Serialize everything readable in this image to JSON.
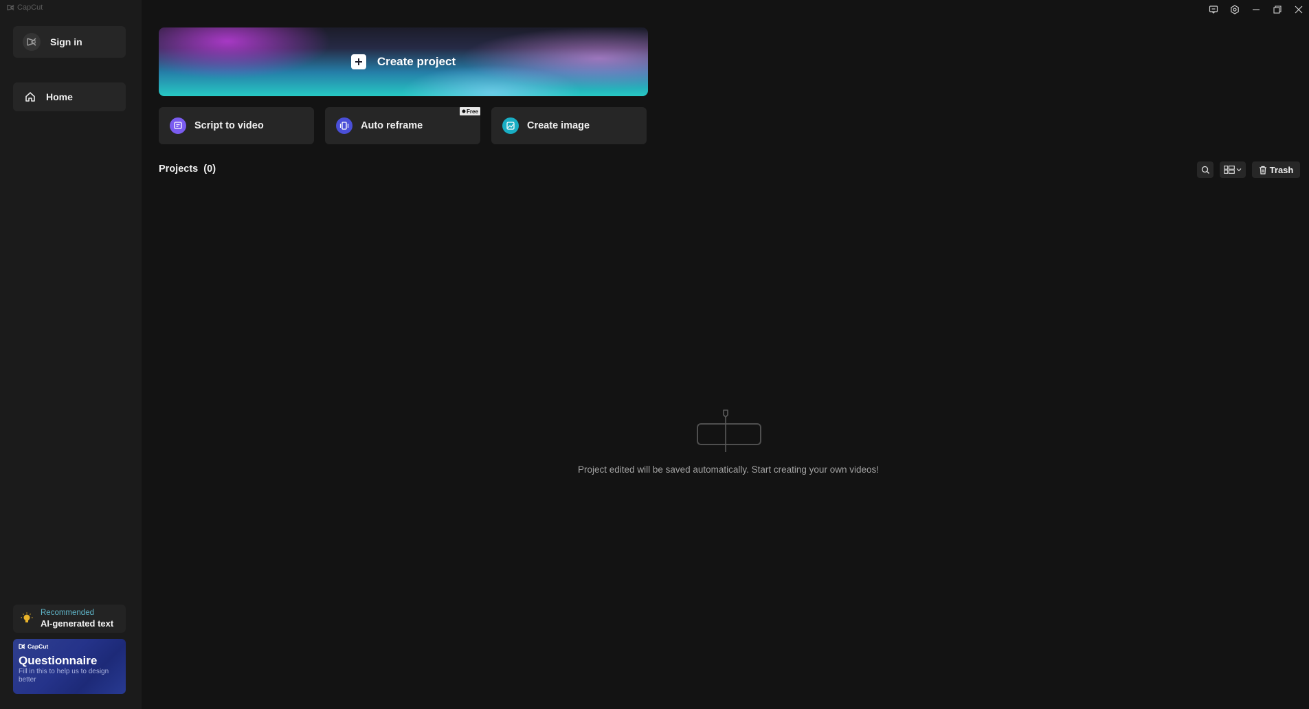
{
  "app": {
    "name": "CapCut"
  },
  "window_controls": {
    "icons": [
      "feedback-icon",
      "settings-icon",
      "minimize-icon",
      "restore-icon",
      "close-icon"
    ]
  },
  "sidebar": {
    "sign_in_label": "Sign in",
    "nav": [
      {
        "label": "Home",
        "icon": "home-icon",
        "selected": true
      }
    ],
    "recommended": {
      "kicker": "Recommended",
      "title": "AI-generated text"
    },
    "questionnaire": {
      "brand": "CapCut",
      "title": "Questionnaire",
      "subtitle": "Fill in this to help us to design better"
    }
  },
  "main": {
    "create_project_label": "Create project",
    "tools": [
      {
        "label": "Script to video",
        "icon": "script-icon",
        "color": "#7a5cf0"
      },
      {
        "label": "Auto reframe",
        "icon": "reframe-icon",
        "color": "#4a4fd8",
        "badge": "Free"
      },
      {
        "label": "Create image",
        "icon": "image-icon",
        "color": "#19aec4"
      }
    ],
    "projects": {
      "title": "Projects",
      "count": "(0)",
      "trash_label": "Trash",
      "empty_message": "Project edited will be saved automatically. Start creating your own videos!"
    }
  }
}
